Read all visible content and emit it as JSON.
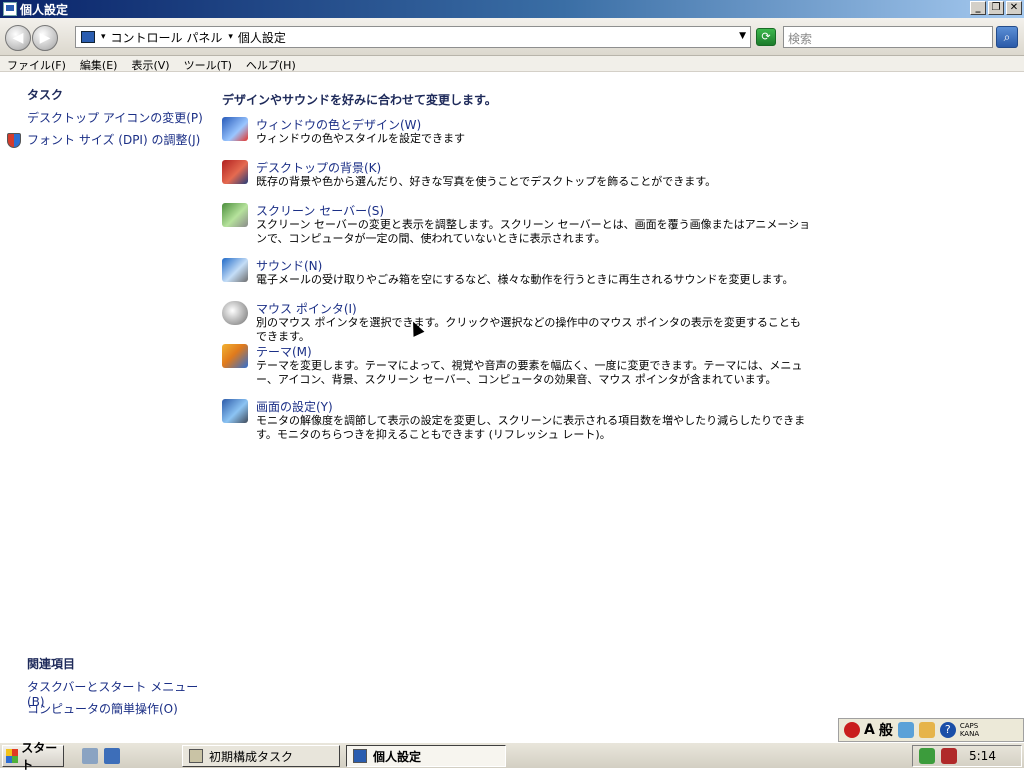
{
  "window": {
    "title": "個人設定"
  },
  "addressbar": {
    "path": [
      "コントロール パネル",
      "個人設定"
    ],
    "search_placeholder": "検索"
  },
  "menubar": {
    "items": [
      "ファイル(F)",
      "編集(E)",
      "表示(V)",
      "ツール(T)",
      "ヘルプ(H)"
    ]
  },
  "tasks": {
    "heading": "タスク",
    "links": [
      "デスクトップ アイコンの変更(P)",
      "フォント サイズ (DPI) の調整(J)"
    ]
  },
  "related": {
    "heading": "関連項目",
    "links": [
      "タスクバーとスタート メニュー(B)",
      "コンピュータの簡単操作(O)"
    ]
  },
  "main": {
    "heading": "デザインやサウンドを好みに合わせて変更します。",
    "items": [
      {
        "title": "ウィンドウの色とデザイン(W)",
        "desc": "ウィンドウの色やスタイルを設定できます",
        "icon": "window-colors-icon"
      },
      {
        "title": "デスクトップの背景(K)",
        "desc": "既存の背景や色から選んだり、好きな写真を使うことでデスクトップを飾ることができます。",
        "icon": "desktop-background-icon"
      },
      {
        "title": "スクリーン セーバー(S)",
        "desc": "スクリーン セーバーの変更と表示を調整します。スクリーン セーバーとは、画面を覆う画像またはアニメーションで、コンピュータが一定の間、使われていないときに表示されます。",
        "icon": "screensaver-icon"
      },
      {
        "title": "サウンド(N)",
        "desc": "電子メールの受け取りやごみ箱を空にするなど、様々な動作を行うときに再生されるサウンドを変更します。",
        "icon": "sound-icon"
      },
      {
        "title": "マウス ポインタ(I)",
        "desc": "別のマウス ポインタを選択できます。クリックや選択などの操作中のマウス ポインタの表示を変更することもできます。",
        "icon": "mouse-pointer-icon"
      },
      {
        "title": "テーマ(M)",
        "desc": "テーマを変更します。テーマによって、視覚や音声の要素を幅広く、一度に変更できます。テーマには、メニュー、アイコン、背景、スクリーン セーバー、コンピュータの効果音、マウス ポインタが含まれています。",
        "icon": "theme-icon"
      },
      {
        "title": "画面の設定(Y)",
        "desc": "モニタの解像度を調節して表示の設定を変更し、スクリーンに表示される項目数を増やしたり減らしたりできます。モニタのちらつきを抑えることもできます (リフレッシュ レート)。",
        "icon": "display-settings-icon"
      }
    ]
  },
  "langbar": {
    "ime_mode": "A",
    "ime_label": "般",
    "caps": "CAPS",
    "kana": "KANA"
  },
  "taskbar": {
    "start_label": "スタート",
    "tasks": [
      "初期構成タスク",
      "個人設定"
    ],
    "clock": "5:14"
  }
}
